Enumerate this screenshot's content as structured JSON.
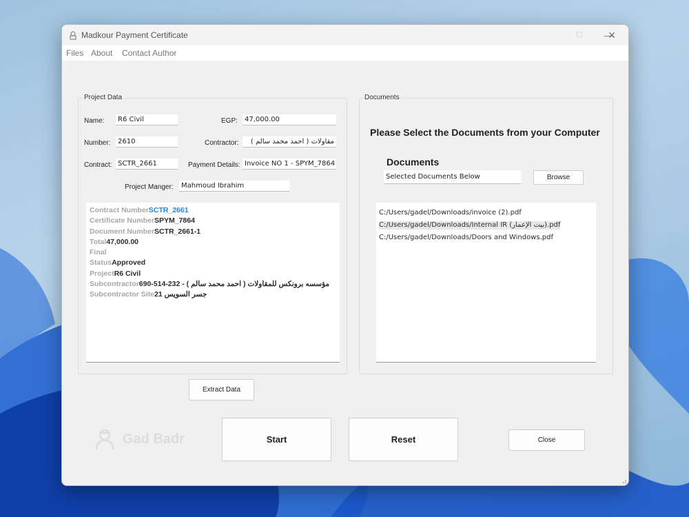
{
  "window": {
    "title": "Madkour Payment Certificate",
    "controls": {
      "minimize": "—",
      "maximize": "☐",
      "close": "✕"
    }
  },
  "menu": {
    "items": [
      "Files",
      "About",
      "Contact Author"
    ]
  },
  "project": {
    "group_title": "Project Data",
    "name_label": "Name:",
    "name_value": "R6 Civil",
    "egp_label": "EGP:",
    "egp_value": "47,000.00",
    "number_label": "Number:",
    "number_value": "2610",
    "contractor_label": "Contractor:",
    "contractor_value": "مقاولات ( احمد محمد سالم )",
    "contract_label": "Contract:",
    "contract_value": "SCTR_2661",
    "payment_label": "Payment Details:",
    "payment_value": "Invoice NO 1 - SPYM_7864",
    "manager_label": "Project Manger:",
    "manager_value": "Mahmoud Ibrahim",
    "summary": [
      {
        "key": "Contract Number",
        "value": "SCTR_2661",
        "blue": true
      },
      {
        "key": "Certificate Number",
        "value": "SPYM_7864"
      },
      {
        "key": "Document Number",
        "value": "SCTR_2661-1"
      },
      {
        "key": "Total",
        "value": "47,000.00"
      },
      {
        "key": "Final",
        "value": ""
      },
      {
        "key": "Status",
        "value": "Approved"
      },
      {
        "key": "Project",
        "value": "R6 Civil"
      },
      {
        "key": "Subcontractor",
        "value": "690-514-232 - ( احمد محمد سالم ) مؤسسه برونكس للمقاولات"
      },
      {
        "key": "Subcontractor Site",
        "value": "21 جسر السويس"
      }
    ]
  },
  "documents": {
    "group_title": "Documents",
    "heading": "Please Select the  Documents from your Computer",
    "subheading": "Documents",
    "selected_field": "Selected Documents Below",
    "browse_label": "Browse",
    "files": [
      "C:/Users/gadel/Downloads/invoice (2).pdf",
      "C:/Users/gadel/Downloads/Internal IR (بيت الإعمار).pdf",
      "C:/Users/gadel/Downloads/Doors and Windows.pdf"
    ]
  },
  "actions": {
    "extract_label": "Extract Data",
    "start_label": "Start",
    "reset_label": "Reset",
    "close_label": "Close"
  },
  "logo": {
    "text": "Gad Badr"
  }
}
